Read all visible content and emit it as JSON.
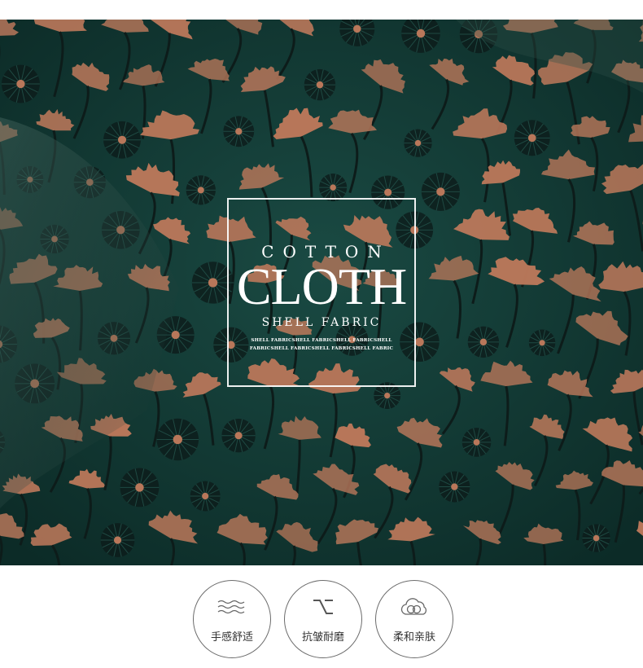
{
  "banner": {
    "line1": "COTTON",
    "line2": "CLOTH",
    "line3": "SHELL FABRIC",
    "small_text": "SHELL FABRICSHELL FABRICSHELL FABRICSHELL FABRICSHELL FABRICSHELL FABRICSHELL FABRIC"
  },
  "features": [
    {
      "label": "手感舒适",
      "icon": "wave-lines-icon"
    },
    {
      "label": "抗皱耐磨",
      "icon": "crease-resistant-icon"
    },
    {
      "label": "柔和亲肤",
      "icon": "cloud-icon"
    }
  ],
  "colors": {
    "fabric_green": "#123d37",
    "flower_copper": "#b9775a",
    "flower_dark": "#0d1c1a",
    "frame_white": "#ffffff",
    "circle_border": "#6c6c6c"
  }
}
